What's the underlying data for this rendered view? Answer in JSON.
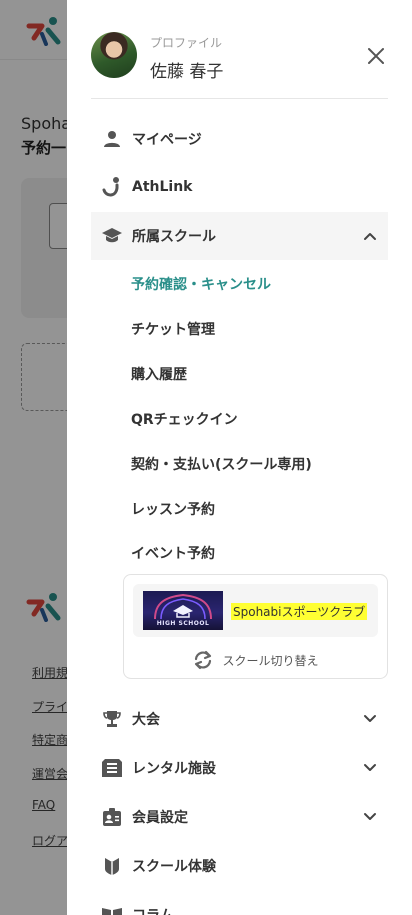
{
  "background": {
    "text_line1": "Spoha",
    "text_line2": "予約一",
    "footer_links": [
      "利用規",
      "プライ",
      "特定商",
      "運営会",
      "FAQ",
      "ログア"
    ]
  },
  "drawer": {
    "profile": {
      "caption": "プロファイル",
      "name": "佐藤 春子"
    },
    "menu": {
      "mypage": "マイページ",
      "athlink": "AthLink",
      "school": "所属スクール",
      "tournament": "大会",
      "rental": "レンタル施設",
      "member_settings": "会員設定",
      "school_trial": "スクール体験",
      "column": "コラム"
    },
    "school_sub": [
      "予約確認・キャンセル",
      "チケット管理",
      "購入履歴",
      "QRチェックイン",
      "契約・支払い(スクール専用)",
      "レッスン予約",
      "イベント予約"
    ],
    "school_card": {
      "name": "Spohabiスポーツクラブ",
      "image_caption": "HIGH SCHOOL",
      "switch_label": "スクール切り替え"
    }
  },
  "colors": {
    "accent": "#2a8f8a",
    "highlight": "#ffff33",
    "logo_red": "#e0473d",
    "logo_teal": "#2a8f8a"
  }
}
